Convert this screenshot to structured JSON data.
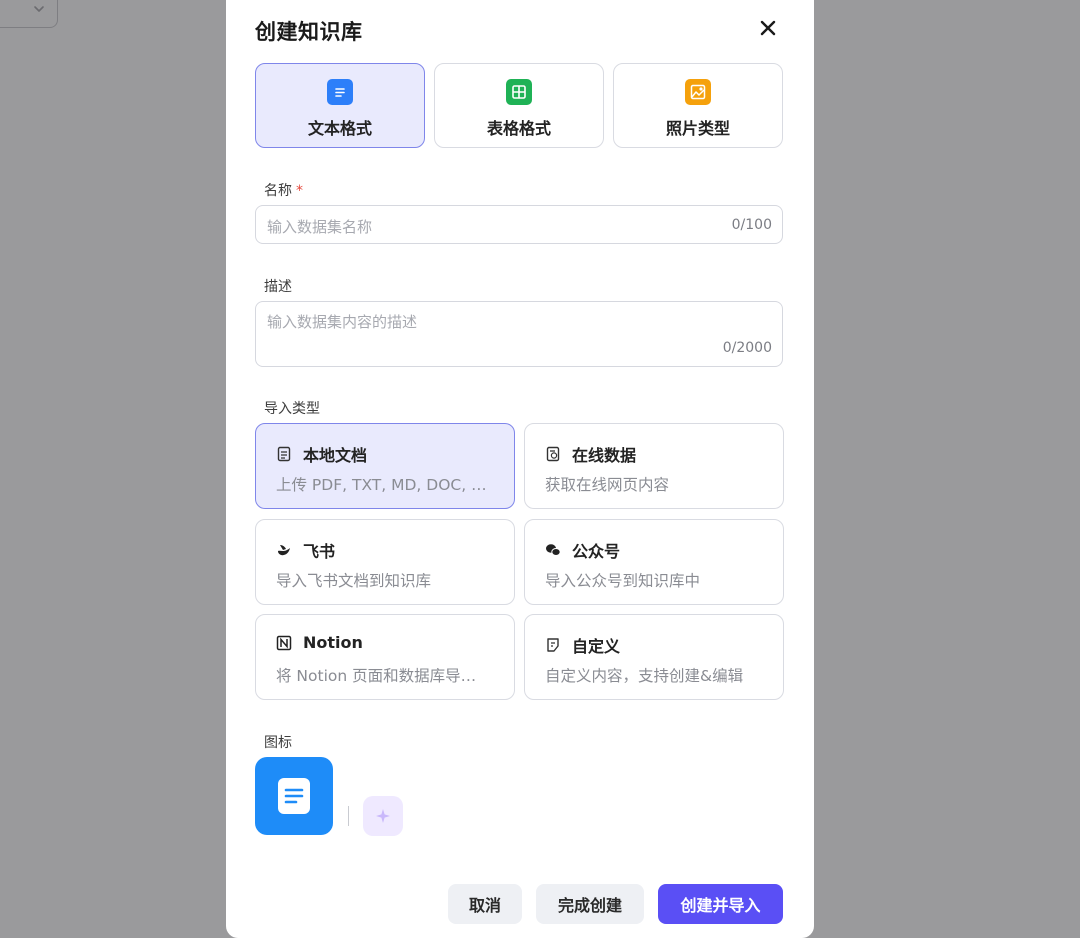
{
  "dialog": {
    "title": "创建知识库",
    "close_icon": "close-icon"
  },
  "types": [
    {
      "label": "文本格式",
      "icon": "text-doc-icon",
      "color": "#2d7ff9",
      "active": true
    },
    {
      "label": "表格格式",
      "icon": "table-icon",
      "color": "#1fb256",
      "active": false
    },
    {
      "label": "照片类型",
      "icon": "image-icon",
      "color": "#f5a10c",
      "active": false
    }
  ],
  "name": {
    "label": "名称",
    "required_mark": "*",
    "placeholder": "输入数据集名称",
    "counter": "0/100"
  },
  "description": {
    "label": "描述",
    "placeholder": "输入数据集内容的描述",
    "counter": "0/2000"
  },
  "import": {
    "label": "导入类型",
    "options": [
      {
        "title": "本地文档",
        "desc": "上传 PDF, TXT, MD, DOC, …",
        "icon": "file-icon",
        "active": true
      },
      {
        "title": "在线数据",
        "desc": "获取在线网页内容",
        "icon": "web-doc-icon",
        "active": false
      },
      {
        "title": "飞书",
        "desc": "导入飞书文档到知识库",
        "icon": "feishu-icon",
        "active": false
      },
      {
        "title": "公众号",
        "desc": "导入公众号到知识库中",
        "icon": "wechat-icon",
        "active": false
      },
      {
        "title": "Notion",
        "desc": "将 Notion 页面和数据库导…",
        "icon": "notion-icon",
        "active": false
      },
      {
        "title": "自定义",
        "desc": "自定义内容，支持创建&编辑",
        "icon": "custom-doc-icon",
        "active": false
      }
    ]
  },
  "icon_section": {
    "label": "图标",
    "tile_icon": "document-icon",
    "tile_color": "#1e8cf8",
    "ai_icon": "sparkle-icon"
  },
  "footer": {
    "cancel": "取消",
    "finish": "完成创建",
    "create_import": "创建并导入",
    "primary_color": "#5a4ff5"
  }
}
